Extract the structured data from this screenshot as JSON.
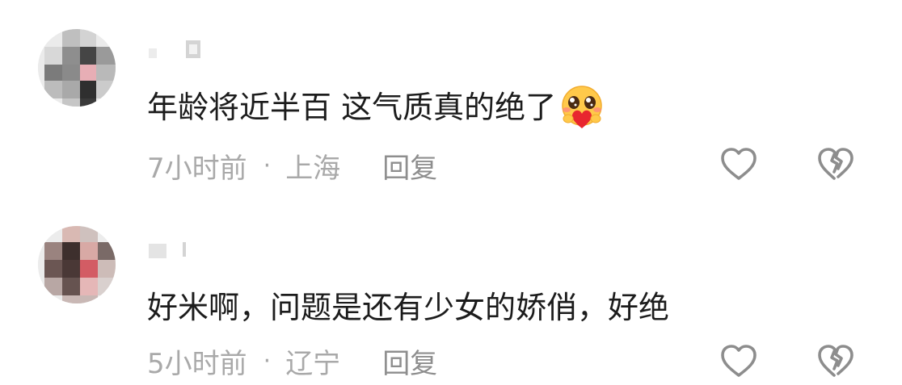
{
  "comments": [
    {
      "username": "",
      "text": "年龄将近半百 这气质真的绝了",
      "emoji": "heart-hug-emoji",
      "time": "7小时前",
      "separator": "·",
      "location": "上海",
      "reply_label": "回复"
    },
    {
      "username": "",
      "text": "好米啊，问题是还有少女的娇俏，好绝",
      "time": "5小时前",
      "separator": "·",
      "location": "辽宁",
      "reply_label": "回复"
    }
  ],
  "colors": {
    "text": "#1c1c1c",
    "meta": "#a9a9a9",
    "reply": "#8e8e8e",
    "icon": "#8d8d8d"
  }
}
